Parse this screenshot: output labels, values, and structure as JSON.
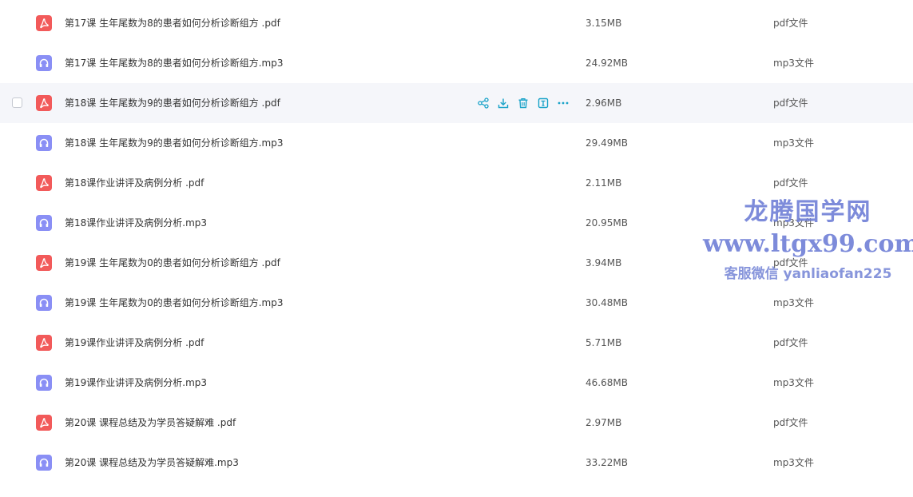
{
  "icons": {
    "pdf": "pdf-file-icon",
    "mp3": "audio-file-icon",
    "pdf_color": "#f25a5a",
    "mp3_color": "#8a8ff5",
    "action_color": "#1ba3c9"
  },
  "files": [
    {
      "name": "第17课 生年尾数为8的患者如何分析诊断组方 .pdf",
      "size": "3.15MB",
      "type": "pdf文件",
      "kind": "pdf"
    },
    {
      "name": "第17课 生年尾数为8的患者如何分析诊断组方.mp3",
      "size": "24.92MB",
      "type": "mp3文件",
      "kind": "mp3"
    },
    {
      "name": "第18课 生年尾数为9的患者如何分析诊断组方 .pdf",
      "size": "2.96MB",
      "type": "pdf文件",
      "kind": "pdf",
      "hovered": true
    },
    {
      "name": "第18课 生年尾数为9的患者如何分析诊断组方.mp3",
      "size": "29.49MB",
      "type": "mp3文件",
      "kind": "mp3"
    },
    {
      "name": "第18课作业讲评及病例分析 .pdf",
      "size": "2.11MB",
      "type": "pdf文件",
      "kind": "pdf"
    },
    {
      "name": "第18课作业讲评及病例分析.mp3",
      "size": "20.95MB",
      "type": "mp3文件",
      "kind": "mp3"
    },
    {
      "name": "第19课 生年尾数为0的患者如何分析诊断组方 .pdf",
      "size": "3.94MB",
      "type": "pdf文件",
      "kind": "pdf"
    },
    {
      "name": "第19课 生年尾数为0的患者如何分析诊断组方.mp3",
      "size": "30.48MB",
      "type": "mp3文件",
      "kind": "mp3"
    },
    {
      "name": "第19课作业讲评及病例分析 .pdf",
      "size": "5.71MB",
      "type": "pdf文件",
      "kind": "pdf"
    },
    {
      "name": "第19课作业讲评及病例分析.mp3",
      "size": "46.68MB",
      "type": "mp3文件",
      "kind": "mp3"
    },
    {
      "name": "第20课 课程总结及为学员答疑解难 .pdf",
      "size": "2.97MB",
      "type": "pdf文件",
      "kind": "pdf"
    },
    {
      "name": "第20课 课程总结及为学员答疑解难.mp3",
      "size": "33.22MB",
      "type": "mp3文件",
      "kind": "mp3"
    }
  ],
  "watermark": {
    "title": "龙腾国学网",
    "url": "www.ltgx99.com",
    "contact": "客服微信 yanliaofan225"
  }
}
